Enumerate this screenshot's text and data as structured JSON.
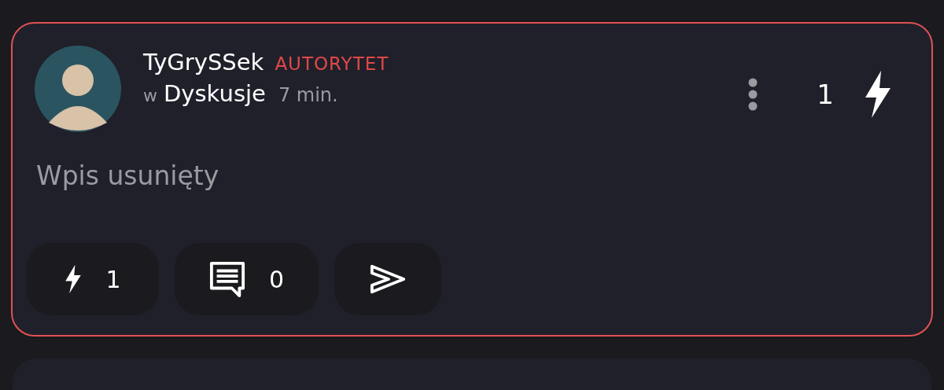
{
  "post": {
    "author": "TyGrySSek",
    "badge": "AUTORYTET",
    "category_prefix": "w",
    "category": "Dyskusje",
    "time": "7 min.",
    "score": "1",
    "content": "Wpis usunięty",
    "highlighted": true,
    "actions": [
      {
        "kind": "vote",
        "count": "1"
      },
      {
        "kind": "comments",
        "count": "0"
      },
      {
        "kind": "share"
      }
    ]
  }
}
